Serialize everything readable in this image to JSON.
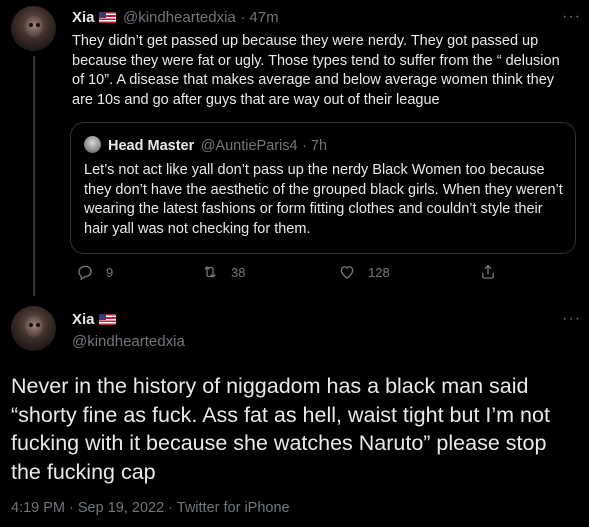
{
  "tweet1": {
    "author_name": "Xia",
    "author_handle": "@kindheartedxia",
    "time_ago": "· 47m",
    "more_label": "···",
    "text": "They didn’t get passed up because they were nerdy. They got passed up because they were fat or ugly. Those types tend to suffer from the “ delusion of 10”. A disease that makes average and below average women think they are 10s and go after guys that are way out of their league",
    "quote": {
      "author_name": "Head Master",
      "author_handle": "@AuntieParis4",
      "time_ago": "· 7h",
      "text": "Let’s not act like yall don’t pass up the nerdy Black Women too because they don’t have the aesthetic of the grouped black girls. When they weren’t wearing the latest fashions or form fitting clothes and couldn’t style their hair yall was not checking for them."
    },
    "actions": {
      "replies": "9",
      "retweets": "38",
      "likes": "128"
    }
  },
  "tweet2": {
    "author_name": "Xia",
    "author_handle": "@kindheartedxia",
    "more_label": "···",
    "text": "Never in the history of niggadom has a black man said “shorty fine as fuck. Ass fat as hell, waist tight but I’m not fucking with it because she watches Naruto” please stop the fucking cap",
    "timestamp": "4:19 PM · Sep 19, 2022 · Twitter for iPhone"
  },
  "icons": {
    "reply": "reply-icon",
    "retweet": "retweet-icon",
    "like": "heart-icon",
    "share": "share-icon",
    "flag": "us-flag-icon",
    "more": "more-icon"
  },
  "colors": {
    "background": "#000000",
    "text": "#e7e9ea",
    "muted": "#71767b",
    "border": "#2f3336"
  }
}
